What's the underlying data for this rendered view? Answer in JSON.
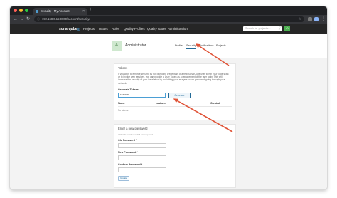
{
  "browser": {
    "tab_title": "Security - My Account",
    "tab_close": "×",
    "new_tab": "+",
    "url": "192.168.0.15:9000/account/security/",
    "back": "←",
    "forward": "→",
    "reload": "↻"
  },
  "nav": {
    "logo": "sonarqube",
    "logo_mark": ")))",
    "links": [
      "Projects",
      "Issues",
      "Rules",
      "Quality Profiles",
      "Quality Gates",
      "Administration"
    ],
    "search_placeholder": "Search for projects, sub-projects and files...",
    "help_icon": "?",
    "avatar_letter": "A"
  },
  "account": {
    "avatar_letter": "A",
    "name": "Administrator",
    "tabs": [
      "Profile",
      "Security",
      "Notifications",
      "Projects"
    ],
    "active_tab": "Security"
  },
  "tokens": {
    "title": "Tokens",
    "description": "If you want to enforce security by not providing credentials of a real SonarQube user to run your code scan or to invoke web services, you can provide a User Token as a replacement of the user login. This will increase the security of your installation by not letting your analysis user's password going through your network.",
    "generate_label": "Generate Tokens",
    "input_value": "scanner",
    "generate_button": "Generate",
    "columns": [
      "Name",
      "Last use",
      "Created"
    ],
    "empty": "No tokens"
  },
  "password": {
    "title": "Enter a new password",
    "required_note": "All fields marked with * are required",
    "old_label": "Old Password *",
    "new_label": "New Password *",
    "confirm_label": "Confirm Password *",
    "submit": "Update"
  },
  "colors": {
    "accent": "#236a97",
    "annotation_arrow": "#e05438",
    "nav_background": "#262626"
  }
}
